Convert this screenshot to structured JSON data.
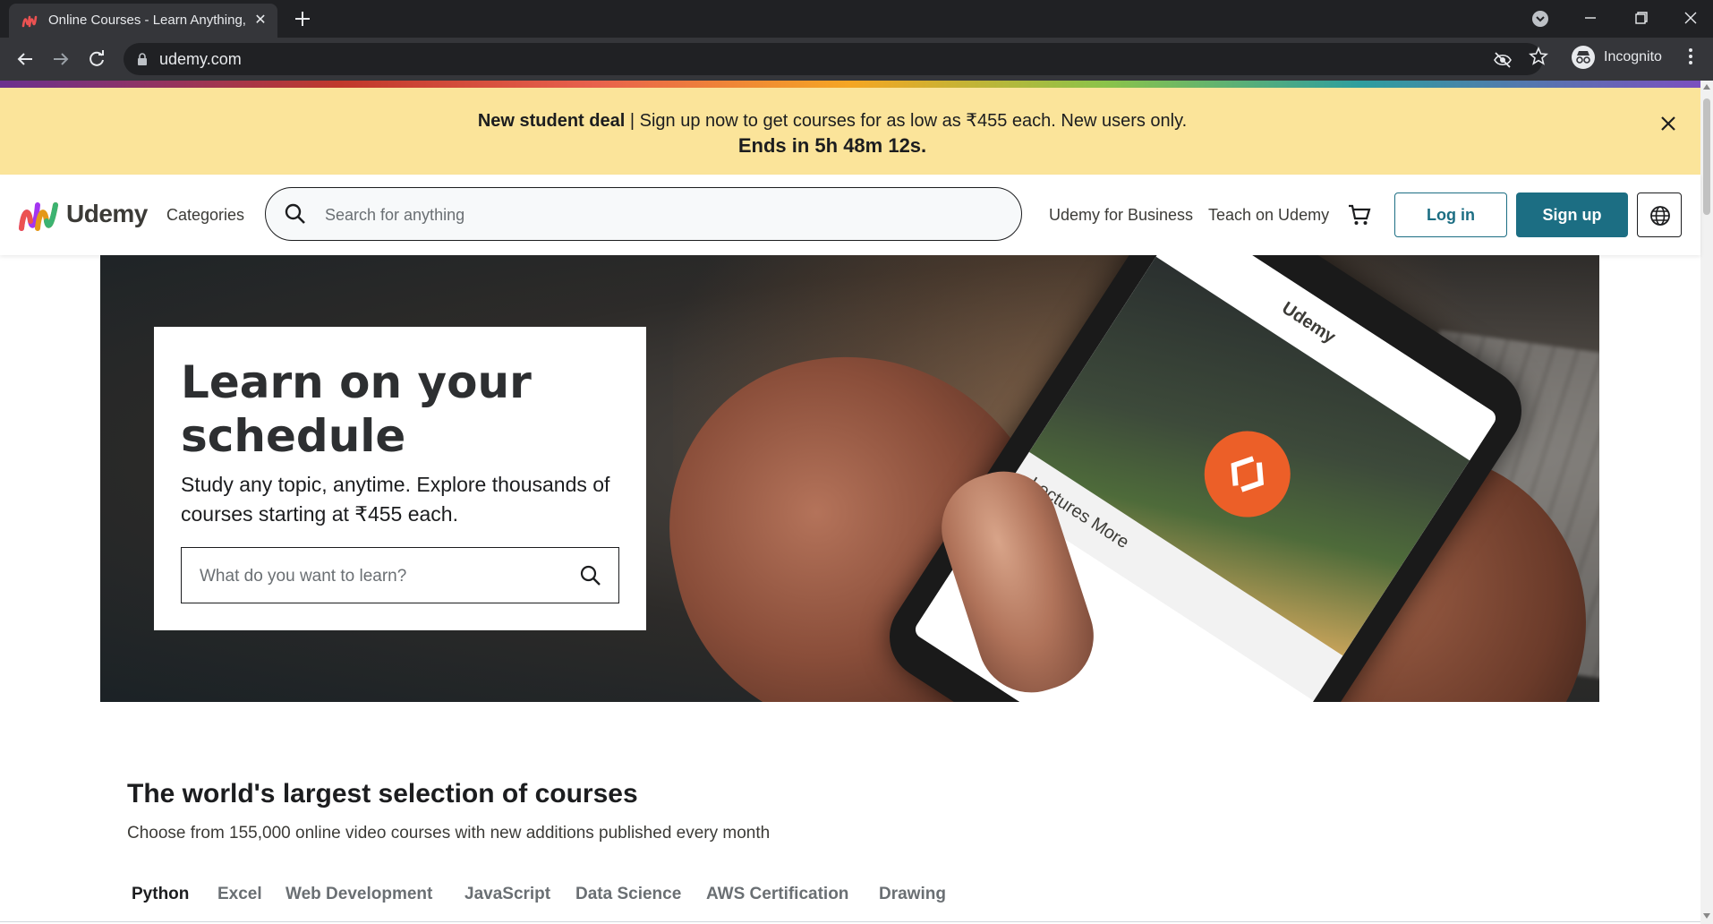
{
  "browser": {
    "tab": {
      "title": "Online Courses - Learn Anything, On Your Schedule | Udemy"
    },
    "address": {
      "url": "udemy.com"
    },
    "profile": {
      "label": "Incognito"
    }
  },
  "deal_banner": {
    "headline": "New student deal",
    "message": " | Sign up now to get courses for as low as ₹455 each. New users only.",
    "countdown": "Ends in 5h 48m 12s."
  },
  "header": {
    "logo_text": "Udemy",
    "categories": "Categories",
    "search_placeholder": "Search for anything",
    "business": "Udemy for Business",
    "teach": "Teach on Udemy",
    "login": "Log in",
    "signup": "Sign up"
  },
  "hero": {
    "title": "Learn on your schedule",
    "subtitle": "Study any topic, anytime. Explore thousands of courses starting at ₹455 each.",
    "search_placeholder": "What do you want to learn?",
    "phone_screen": {
      "brand": "Udemy",
      "tabs": "Lectures    More"
    }
  },
  "courses": {
    "title": "The world's largest selection of courses",
    "subtitle": "Choose from 155,000 online video courses with new additions published every month",
    "topics": [
      "Python",
      "Excel",
      "Web Development",
      "JavaScript",
      "Data Science",
      "AWS Certification",
      "Drawing"
    ],
    "active_topic": "Python"
  },
  "colors": {
    "banner_bg": "#fbe49a",
    "brand_teal": "#1c6e83",
    "accent_orange": "#ec5f28"
  }
}
